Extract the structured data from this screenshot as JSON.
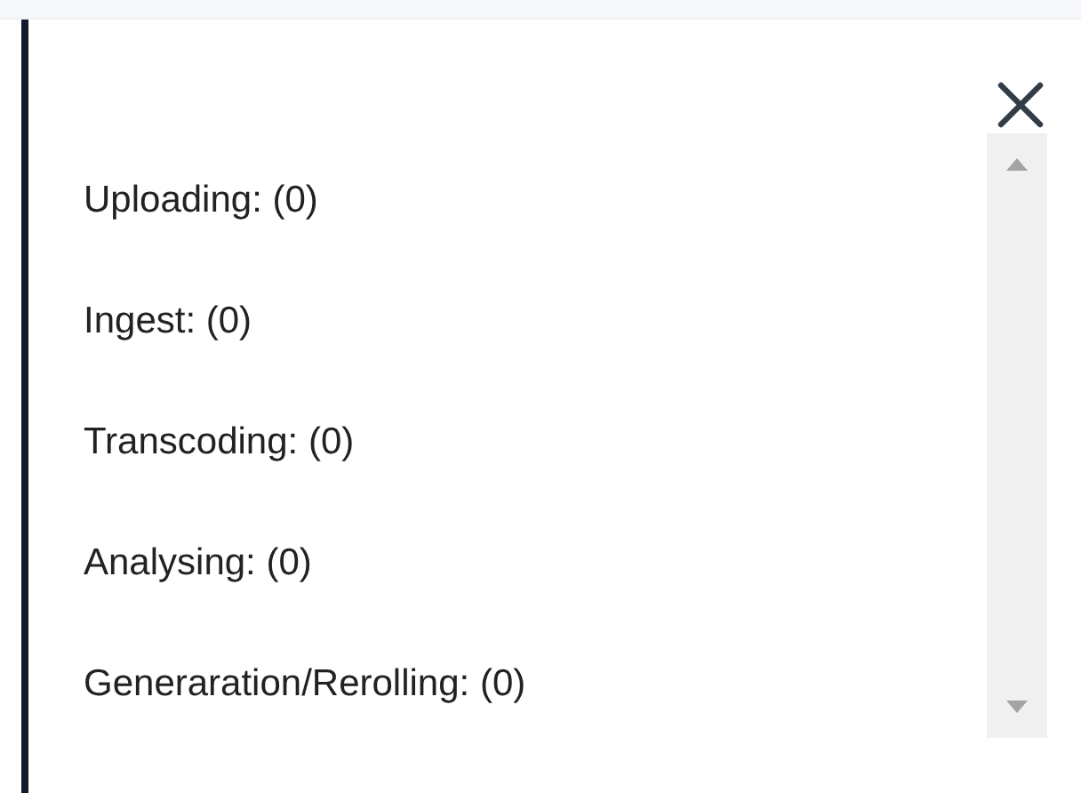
{
  "status_list": [
    {
      "label": "Uploading: (0)"
    },
    {
      "label": "Ingest: (0)"
    },
    {
      "label": "Transcoding: (0)"
    },
    {
      "label": "Analysing: (0)"
    },
    {
      "label": "Generaration/Rerolling: (0)"
    }
  ]
}
